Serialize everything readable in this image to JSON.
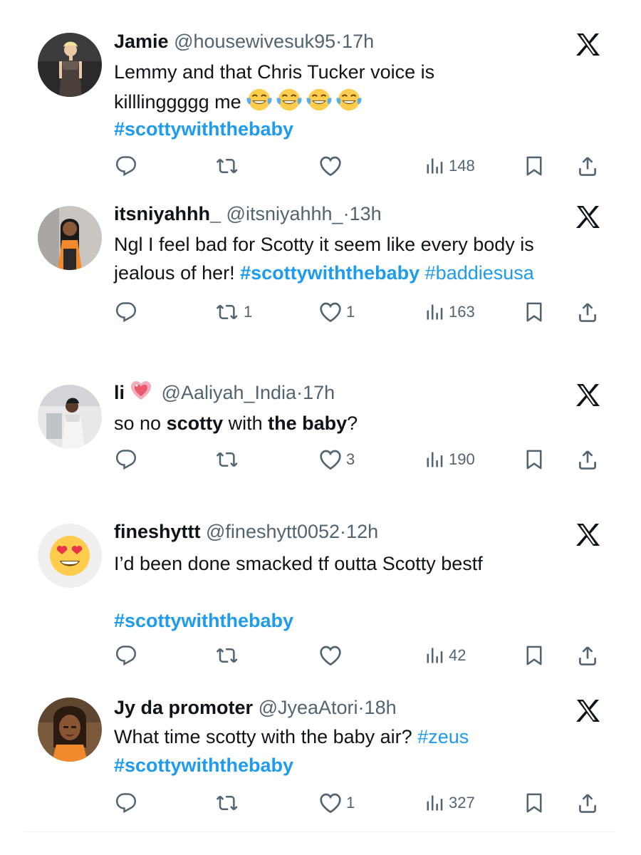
{
  "colors": {
    "text": "#0f1419",
    "muted": "#536471",
    "link": "#1d9bf0",
    "background": "#ffffff"
  },
  "tweets": [
    {
      "name": "Jamie",
      "handle": "@housewivesuk95",
      "sep": "·",
      "time": "17h",
      "lines": [
        [
          {
            "t": "Lemmy and that Chris Tucker voice is",
            "s": "text"
          }
        ],
        [
          {
            "t": "killlinggggg me",
            "s": "text"
          },
          {
            "emoji": "face-with-tears-of-joy",
            "count": 4
          }
        ],
        [
          {
            "t": "#scottywiththebaby",
            "s": "tag-bold"
          }
        ]
      ],
      "reply_count": "",
      "retweet_count": "",
      "like_count": "",
      "views": "148"
    },
    {
      "name": "itsniyahhh_",
      "handle": "@itsniyahhh_",
      "sep": "·",
      "time": "13h",
      "lines": [
        [
          {
            "t": "Ngl I feel bad for Scotty it seem like every body is",
            "s": "text"
          }
        ],
        [
          {
            "t": "jealous of her! ",
            "s": "text"
          },
          {
            "t": "#scottywiththebaby",
            "s": "tag-bold"
          },
          {
            "t": " #baddiesusa",
            "s": "tag"
          }
        ]
      ],
      "reply_count": "",
      "retweet_count": "1",
      "like_count": "1",
      "views": "163"
    },
    {
      "name": "li",
      "name_emoji": "sparkling-heart",
      "handle": "@Aaliyah_India",
      "sep": "·",
      "time": "17h",
      "lines": [
        [
          {
            "t": "so no ",
            "s": "text"
          },
          {
            "t": "scotty",
            "s": "bold"
          },
          {
            "t": " with ",
            "s": "text"
          },
          {
            "t": "the baby",
            "s": "bold"
          },
          {
            "t": "?",
            "s": "text"
          }
        ]
      ],
      "reply_count": "",
      "retweet_count": "",
      "like_count": "3",
      "views": "190"
    },
    {
      "name": "fineshyttt",
      "handle": "@fineshytt0052",
      "sep": "·",
      "time": "12h",
      "lines": [
        [
          {
            "t": "I’d been done smacked tf outta Scotty bestf",
            "s": "text"
          }
        ],
        [],
        [
          {
            "t": "#scottywiththebaby",
            "s": "tag-bold"
          }
        ]
      ],
      "reply_count": "",
      "retweet_count": "",
      "like_count": "",
      "views": "42"
    },
    {
      "name": "Jy da promoter",
      "handle": "@JyeaAtori",
      "sep": "·",
      "time": "18h",
      "lines": [
        [
          {
            "t": "What time scotty with the baby air? ",
            "s": "text"
          },
          {
            "t": "#zeus",
            "s": "tag"
          }
        ],
        [
          {
            "t": "#scottywiththebaby",
            "s": "tag-bold"
          }
        ]
      ],
      "reply_count": "",
      "retweet_count": "",
      "like_count": "1",
      "views": "327"
    }
  ],
  "icons": {
    "reply": "reply-icon",
    "retweet": "retweet-icon",
    "like": "heart-icon",
    "views": "views-icon",
    "bookmark": "bookmark-icon",
    "share": "share-icon",
    "grok": "grok-x-icon"
  }
}
